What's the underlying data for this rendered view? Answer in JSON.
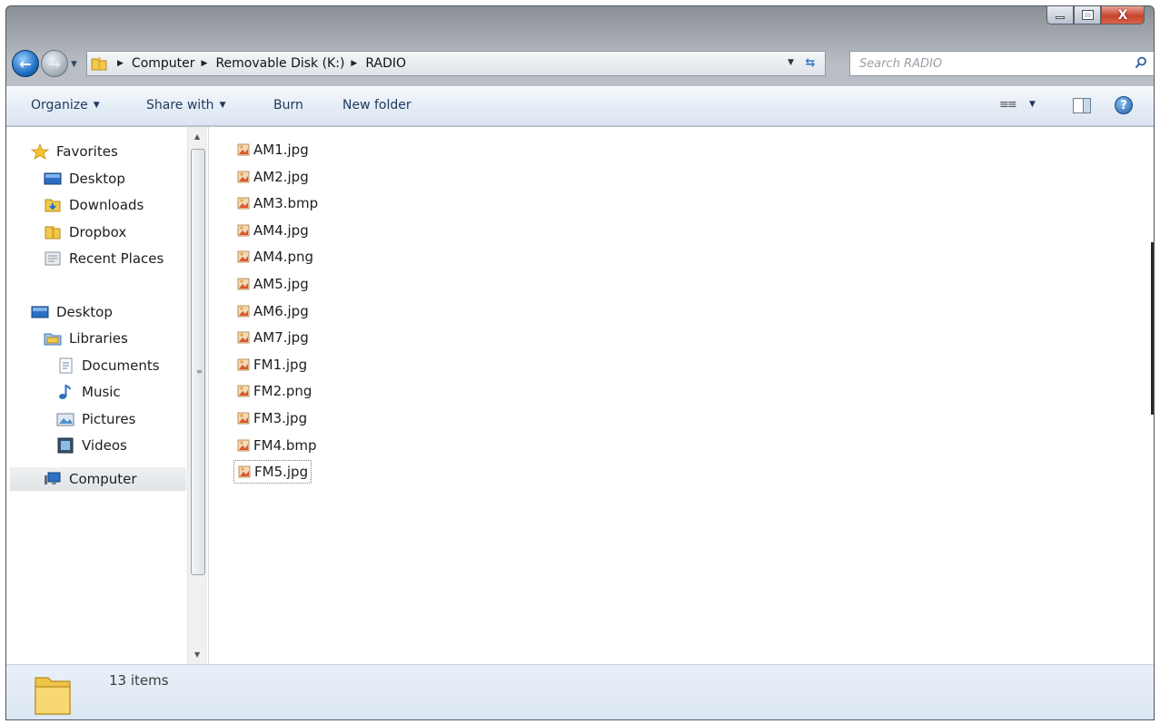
{
  "window": {
    "caption_close": "X"
  },
  "address_bar": {
    "crumbs": [
      "Computer",
      "Removable Disk (K:)",
      "RADIO"
    ]
  },
  "search": {
    "placeholder": "Search RADIO"
  },
  "toolbar": {
    "organize": "Organize",
    "share_with": "Share with",
    "burn": "Burn",
    "new_folder": "New folder",
    "help": "?"
  },
  "nav_pane": {
    "favorites": "Favorites",
    "fav_desktop": "Desktop",
    "fav_downloads": "Downloads",
    "fav_dropbox": "Dropbox",
    "fav_recent": "Recent Places",
    "desktop": "Desktop",
    "libraries": "Libraries",
    "documents": "Documents",
    "music": "Music",
    "pictures": "Pictures",
    "videos": "Videos",
    "computer": "Computer"
  },
  "files": [
    "AM1.jpg",
    "AM2.jpg",
    "AM3.bmp",
    "AM4.jpg",
    "AM4.png",
    "AM5.jpg",
    "AM6.jpg",
    "AM7.jpg",
    "FM1.jpg",
    "FM2.png",
    "FM3.jpg",
    "FM4.bmp",
    "FM5.jpg"
  ],
  "status": {
    "item_count": "13 items"
  },
  "colors": {
    "selection": "#e1e4e8",
    "toolbar": "#dbe5f1",
    "folder_yellow": "#f2c94c",
    "accent_blue": "#1f6fc4"
  }
}
